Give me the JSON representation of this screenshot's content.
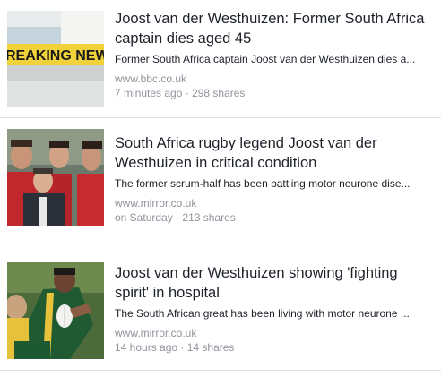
{
  "items": [
    {
      "headline": "Joost van der Westhuizen: Former South Africa captain dies aged 45",
      "summary": "Former South Africa captain Joost van der Westhuizen dies a...",
      "domain": "www.bbc.co.uk",
      "time": "7 minutes ago",
      "shares": "298 shares",
      "thumb_text": "REAKING NEW"
    },
    {
      "headline": "South Africa rugby legend Joost van der Westhuizen in critical condition",
      "summary": "The former scrum-half has been battling motor neurone dise...",
      "domain": "www.mirror.co.uk",
      "time": "on Saturday",
      "shares": "213 shares"
    },
    {
      "headline": "Joost van der Westhuizen showing 'fighting spirit' in hospital",
      "summary": "The South African great has been living with motor neurone ...",
      "domain": "www.mirror.co.uk",
      "time": "14 hours ago",
      "shares": "14 shares"
    }
  ],
  "meta_separator": " · ",
  "colors": {
    "text": "#1d2129",
    "meta": "#90949c",
    "divider": "#dddfe2",
    "breaking_yellow": "#f2d23a"
  }
}
